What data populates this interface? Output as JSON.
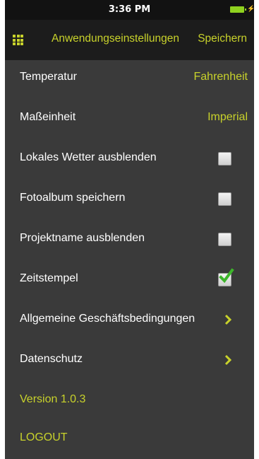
{
  "status_bar": {
    "time": "3:36 PM"
  },
  "nav": {
    "title": "Anwendungseinstellungen",
    "save_label": "Speichern",
    "menu_icon": "grid-menu-icon"
  },
  "settings": {
    "temperature": {
      "label": "Temperatur",
      "value": "Fahrenheit"
    },
    "unit": {
      "label": "Maßeinheit",
      "value": "Imperial"
    },
    "hide_local_weather": {
      "label": "Lokales Wetter ausblenden",
      "checked": false
    },
    "save_photo_album": {
      "label": "Fotoalbum speichern",
      "checked": false
    },
    "hide_project_name": {
      "label": "Projektname ausblenden",
      "checked": false
    },
    "timestamp": {
      "label": "Zeitstempel",
      "checked": true
    },
    "terms": {
      "label": "Allgemeine Geschäftsbedingungen"
    },
    "privacy": {
      "label": "Datenschutz"
    }
  },
  "version": "Version 1.0.3",
  "logout": "LOGOUT",
  "colors": {
    "accent": "#c8d22b",
    "check": "#3db52b",
    "background": "#3a3a3a",
    "nav_background": "#1c1c1c"
  }
}
